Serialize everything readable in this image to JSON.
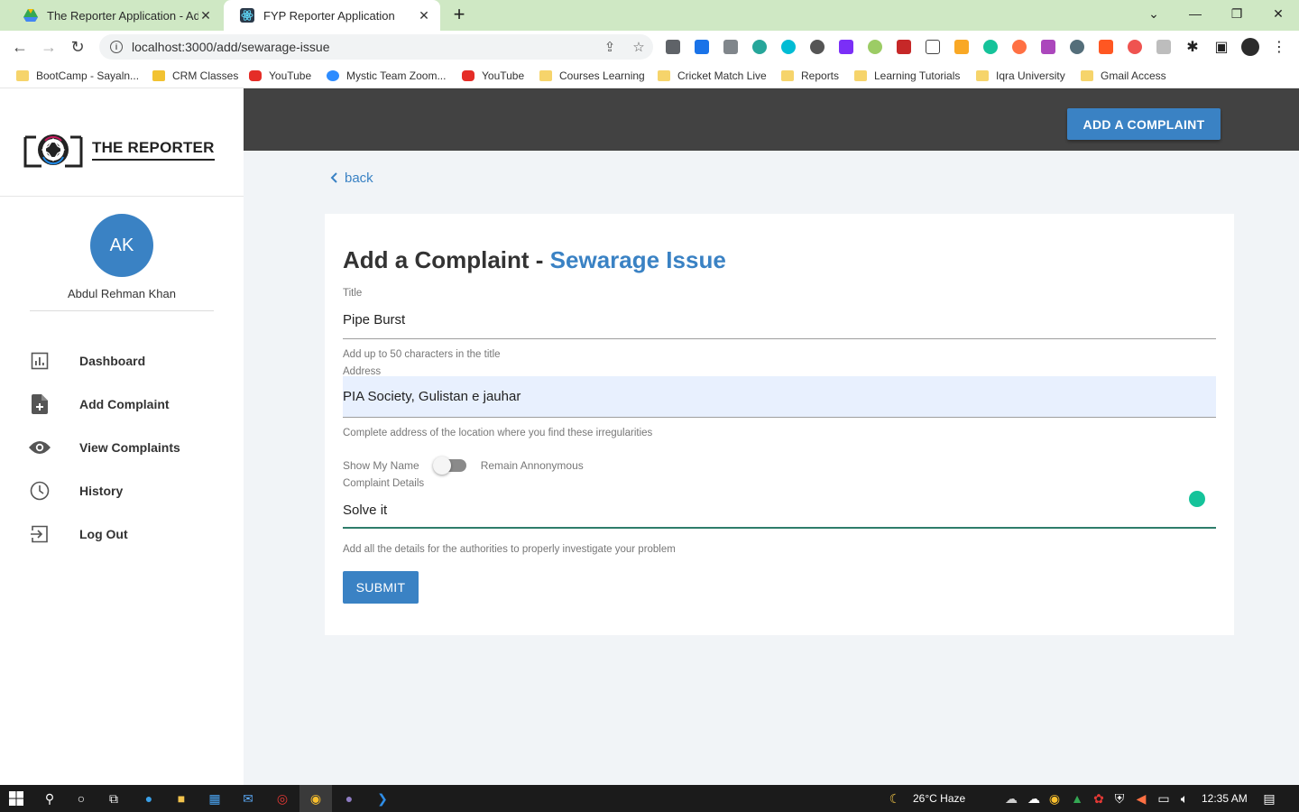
{
  "browser": {
    "tabs": [
      {
        "title": "The Reporter Application - Admin",
        "active": false
      },
      {
        "title": "FYP Reporter Application",
        "active": true
      }
    ],
    "url": "localhost:3000/add/sewarage-issue",
    "bookmarks": [
      {
        "label": "BootCamp - Sayaln...",
        "icon": "folder-icon"
      },
      {
        "label": "CRM Classes",
        "icon": "classroom-icon"
      },
      {
        "label": "YouTube",
        "icon": "youtube-icon"
      },
      {
        "label": "Mystic Team Zoom...",
        "icon": "zoom-icon"
      },
      {
        "label": "YouTube",
        "icon": "youtube-icon"
      },
      {
        "label": "Courses Learning",
        "icon": "folder-icon"
      },
      {
        "label": "Cricket Match Live",
        "icon": "folder-icon"
      },
      {
        "label": "Reports",
        "icon": "folder-icon"
      },
      {
        "label": "Learning Tutorials",
        "icon": "folder-icon"
      },
      {
        "label": "Iqra University",
        "icon": "folder-icon"
      },
      {
        "label": "Gmail Access",
        "icon": "folder-icon"
      }
    ]
  },
  "app": {
    "brand": "THE REPORTER",
    "user": {
      "initials": "AK",
      "name": "Abdul Rehman Khan"
    },
    "nav": [
      {
        "label": "Dashboard",
        "icon": "chart-icon"
      },
      {
        "label": "Add Complaint",
        "icon": "file-add-icon"
      },
      {
        "label": "View Complaints",
        "icon": "eye-icon"
      },
      {
        "label": "History",
        "icon": "clock-icon"
      },
      {
        "label": "Log Out",
        "icon": "logout-icon"
      }
    ],
    "header_button": "ADD A COMPLAINT",
    "back_label": "back",
    "form": {
      "title_prefix": "Add a Complaint - ",
      "title_category": "Sewarage Issue",
      "title_field": {
        "label": "Title",
        "value": "Pipe Burst",
        "helper": "Add up to 50 characters in the title"
      },
      "address_field": {
        "label": "Address",
        "value": "PIA Society, Gulistan e jauhar",
        "helper": "Complete address of the location where you find these irregularities"
      },
      "toggle": {
        "left_label": "Show My Name",
        "right_label": "Remain Annonymous"
      },
      "details_field": {
        "label": "Complaint Details",
        "value": "Solve it",
        "helper": "Add all the details for the authorities to properly investigate your problem"
      },
      "submit_label": "SUBMIT"
    },
    "colors": {
      "accent": "#3a82c4",
      "topbar": "#424242",
      "background": "#f1f4f7"
    }
  },
  "taskbar": {
    "weather": "26°C  Haze",
    "time": "12:35 AM"
  }
}
